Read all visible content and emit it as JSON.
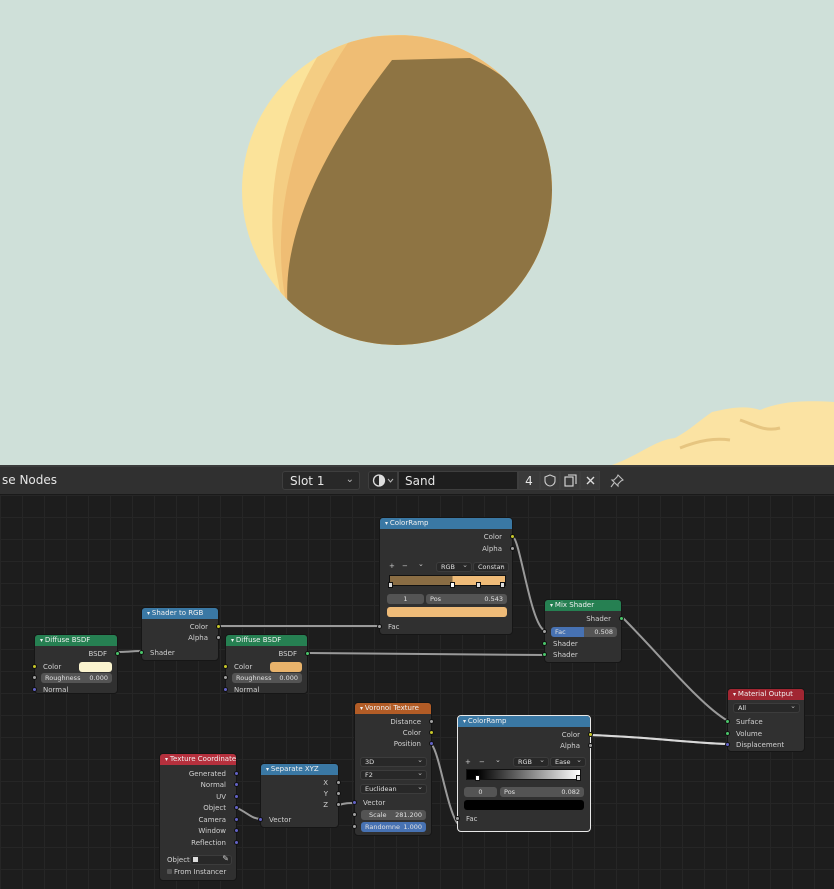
{
  "header": {
    "editor_title": "se Nodes",
    "slot": "Slot 1",
    "material_name": "Sand",
    "user_count": "4"
  },
  "nodes": {
    "diffuse1": {
      "title": "Diffuse BSDF",
      "out_bsdf": "BSDF",
      "color_label": "Color",
      "roughness_label": "Roughness",
      "roughness_value": "0.000",
      "normal_label": "Normal",
      "color": "#fbf4cf"
    },
    "shader_to_rgb": {
      "title": "Shader to RGB",
      "out_color": "Color",
      "out_alpha": "Alpha",
      "in_shader": "Shader"
    },
    "diffuse2": {
      "title": "Diffuse BSDF",
      "out_bsdf": "BSDF",
      "color_label": "Color",
      "roughness_label": "Roughness",
      "roughness_value": "0.000",
      "normal_label": "Normal",
      "color": "#e9b36b"
    },
    "colorramp1": {
      "title": "ColorRamp",
      "out_color": "Color",
      "out_alpha": "Alpha",
      "add": "+",
      "remove": "−",
      "menu": "⌄",
      "color_mode": "RGB",
      "interpolation": "Constan",
      "stop_index": "1",
      "pos_label": "Pos",
      "pos_value": "0.543",
      "in_fac": "Fac",
      "color_left": "#8a6d44",
      "color_right": "#efbb78",
      "selected_color": "#efbb78"
    },
    "mix_shader": {
      "title": "Mix Shader",
      "out_shader": "Shader",
      "fac_label": "Fac",
      "fac_value": "0.508",
      "in_shader1": "Shader",
      "in_shader2": "Shader"
    },
    "material_output": {
      "title": "Material Output",
      "target": "All",
      "in_surface": "Surface",
      "in_volume": "Volume",
      "in_displacement": "Displacement"
    },
    "voronoi": {
      "title": "Voronoi Texture",
      "out_distance": "Distance",
      "out_color": "Color",
      "out_position": "Position",
      "dimensions": "3D",
      "feature": "F2",
      "metric": "Euclidean",
      "in_vector": "Vector",
      "scale_label": "Scale",
      "scale_value": "281.200",
      "random_label": "Randomne",
      "random_value": "1.000"
    },
    "colorramp2": {
      "title": "ColorRamp",
      "out_color": "Color",
      "out_alpha": "Alpha",
      "add": "+",
      "remove": "−",
      "menu": "⌄",
      "color_mode": "RGB",
      "interpolation": "Ease",
      "stop_index": "0",
      "pos_label": "Pos",
      "pos_value": "0.082",
      "in_fac": "Fac",
      "selected_color": "#000000"
    },
    "separate_xyz": {
      "title": "Separate XYZ",
      "out_x": "X",
      "out_y": "Y",
      "out_z": "Z",
      "in_vector": "Vector"
    },
    "texcoord": {
      "title": "Texture Coordinate",
      "outputs": [
        "Generated",
        "Normal",
        "UV",
        "Object",
        "Camera",
        "Window",
        "Reflection"
      ],
      "object_label": "Object",
      "from_instancer": "From Instancer"
    }
  },
  "colors": {
    "viewport_bg": "#cfe0d9",
    "sphere_light": "#fbe39a",
    "sphere_mid": "#f0c075",
    "sphere_dark": "#8e7443",
    "sand_dune": "#fbe3a3"
  }
}
